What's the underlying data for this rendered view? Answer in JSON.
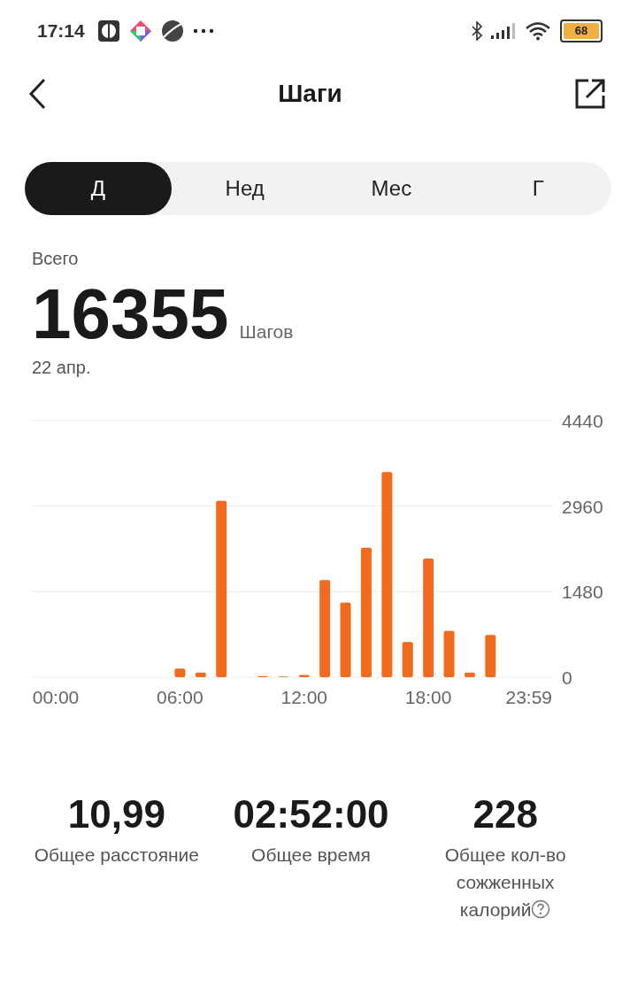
{
  "status_bar": {
    "time": "17:14",
    "battery": "68"
  },
  "header": {
    "title": "Шаги"
  },
  "tabs": [
    {
      "label": "Д",
      "selected": true
    },
    {
      "label": "Нед",
      "selected": false
    },
    {
      "label": "Мес",
      "selected": false
    },
    {
      "label": "Г",
      "selected": false
    }
  ],
  "summary": {
    "label": "Всего",
    "value": "16355",
    "unit": "Шагов",
    "date": "22 апр."
  },
  "chart": {
    "chart_data": {
      "type": "bar",
      "x": [
        0,
        1,
        2,
        3,
        4,
        5,
        6,
        7,
        8,
        9,
        10,
        11,
        12,
        13,
        14,
        15,
        16,
        17,
        18,
        19,
        20,
        21,
        22,
        23
      ],
      "values": [
        0,
        0,
        0,
        0,
        0,
        0,
        150,
        80,
        3050,
        0,
        20,
        10,
        40,
        1680,
        1290,
        2240,
        3550,
        610,
        2050,
        800,
        80,
        730,
        0,
        0
      ],
      "xlim": [
        -1.24,
        24.02
      ],
      "ylim": [
        0,
        4440
      ],
      "yticks": [
        0,
        1480,
        2960,
        4440
      ],
      "xticks": [
        {
          "value": 0,
          "label": "00:00"
        },
        {
          "value": 6,
          "label": "06:00"
        },
        {
          "value": 12,
          "label": "12:00"
        },
        {
          "value": 18,
          "label": "18:00"
        },
        {
          "value": 23.98,
          "label": "23:59"
        }
      ]
    }
  },
  "stats": [
    {
      "value": "10,99",
      "label": "Общее расстояние",
      "info": false
    },
    {
      "value": "02:52:00",
      "label": "Общее время",
      "info": false
    },
    {
      "value": "228",
      "label": "Общее кол-во сожженных калорий",
      "info": true
    }
  ]
}
